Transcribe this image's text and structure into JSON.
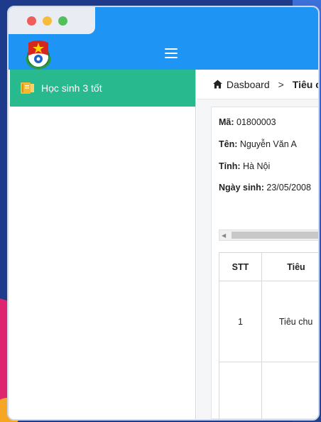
{
  "window": {
    "controls": [
      "close",
      "minimize",
      "maximize"
    ]
  },
  "header": {
    "logo_icon": "youth-union-emblem",
    "menu_icon": "hamburger-icon",
    "color": "#1e95f4"
  },
  "sidebar": {
    "items": [
      {
        "label": "Học sinh 3 tốt",
        "icon": "book-icon",
        "active": true,
        "color": "#28b98f"
      }
    ]
  },
  "breadcrumb": {
    "home": "Dasboard",
    "separator": ">",
    "current": "Tiêu c"
  },
  "student": {
    "ma_label": "Mã:",
    "ma_value": "01800003",
    "ten_label": "Tên:",
    "ten_value": "Nguyễn Văn A",
    "tinh_label": "Tỉnh:",
    "tinh_value": "Hà Nội",
    "ngaysinh_label": "Ngày sinh:",
    "ngaysinh_value": "23/05/2008"
  },
  "table": {
    "headers": [
      "STT",
      "Tiêu"
    ],
    "rows": [
      [
        "1",
        "Tiêu chu"
      ],
      [
        "",
        ""
      ]
    ]
  }
}
